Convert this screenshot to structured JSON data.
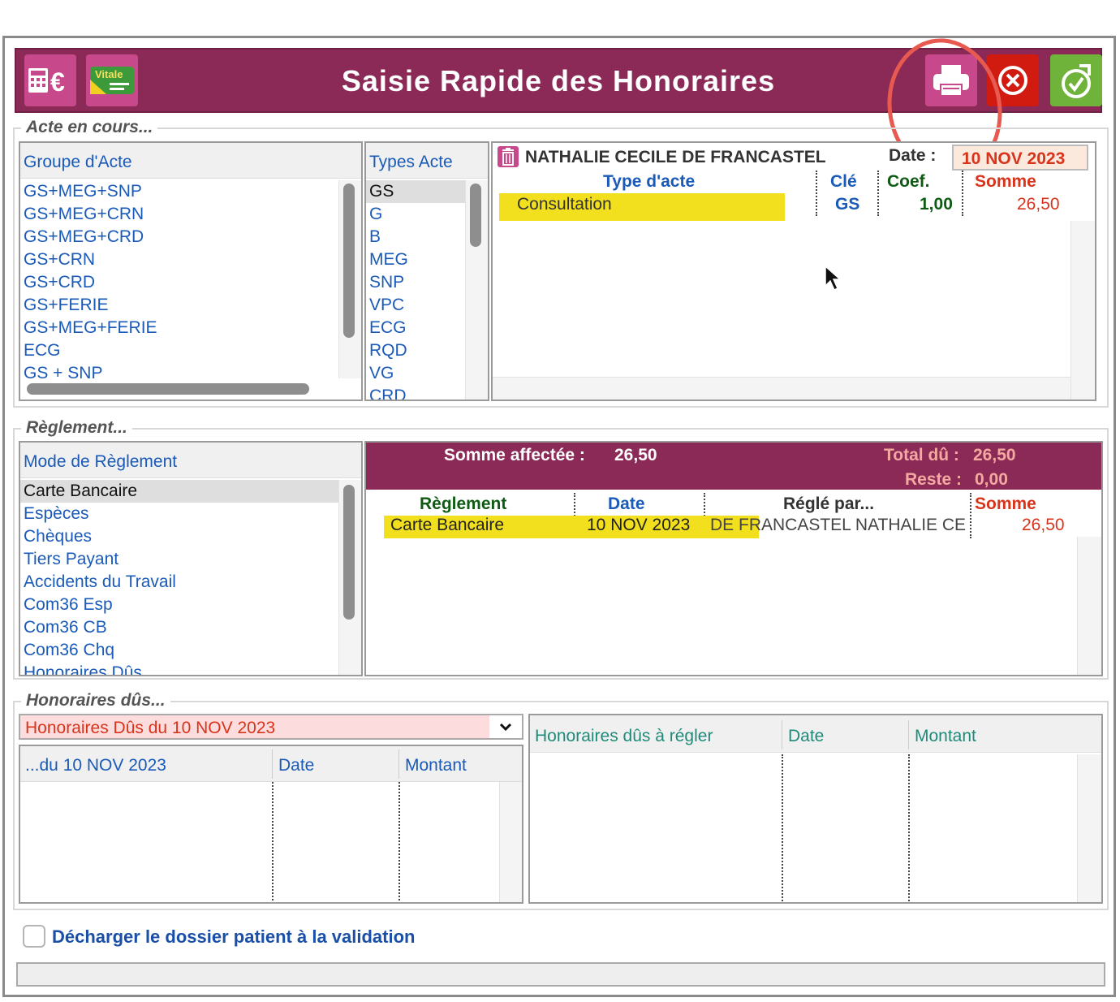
{
  "header": {
    "title": "Saisie Rapide des Honoraires",
    "calc_icon_text": "€",
    "vitale_icon_text": "Vitale"
  },
  "acte": {
    "legend": "Acte en cours...",
    "groupe_header": "Groupe d'Acte",
    "groupe_items": [
      "GS+MEG+SNP",
      "GS+MEG+CRN",
      "GS+MEG+CRD",
      "GS+CRN",
      "GS+CRD",
      "GS+FERIE",
      "GS+MEG+FERIE",
      "ECG",
      "GS + SNP"
    ],
    "types_header": "Types Acte",
    "types_items": [
      "GS",
      "G",
      "B",
      "MEG",
      "SNP",
      "VPC",
      "ECG",
      "RQD",
      "VG",
      "CRD"
    ],
    "patient_name": "NATHALIE CECILE DE FRANCASTEL",
    "date_label": "Date :",
    "date_value": "10 NOV 2023",
    "col_type": "Type d'acte",
    "col_cle": "Clé",
    "col_coef": "Coef.",
    "col_somme": "Somme",
    "row": {
      "type": "Consultation",
      "cle": "GS",
      "coef": "1,00",
      "somme": "26,50"
    }
  },
  "reglement": {
    "legend": "Règlement...",
    "mode_header": "Mode de Règlement",
    "mode_items": [
      "Carte Bancaire",
      "Espèces",
      "Chèques",
      "Tiers Payant",
      "Accidents du Travail",
      "Com36 Esp",
      "Com36 CB",
      "Com36 Chq",
      "Honoraires Dûs"
    ],
    "somme_affectee_label": "Somme affectée :",
    "somme_affectee_value": "26,50",
    "total_du_label": "Total dû :",
    "total_du_value": "26,50",
    "reste_label": "Reste :",
    "reste_value": "0,00",
    "col_reglement": "Règlement",
    "col_date": "Date",
    "col_regle_par": "Réglé par...",
    "col_somme": "Somme",
    "row": {
      "reglement": "Carte Bancaire",
      "date": "10 NOV 2023",
      "regle_par": "DE FRANCASTEL NATHALIE CE",
      "somme": "26,50"
    }
  },
  "honoraires": {
    "legend": "Honoraires dûs...",
    "dropdown_value": "Honoraires Dûs du 10 NOV 2023",
    "left_col_1": "...du 10 NOV 2023",
    "left_col_2": "Date",
    "left_col_3": "Montant",
    "right_col_1": "Honoraires dûs à régler",
    "right_col_2": "Date",
    "right_col_3": "Montant"
  },
  "footer": {
    "checkbox_label": "Décharger le dossier patient à la validation",
    "checkbox_checked": false
  },
  "colors": {
    "titlebar": "#8b2a57",
    "accent_pink": "#c8498b",
    "link_blue": "#1a5ab8",
    "header_green": "#0f5b14",
    "amount_red": "#d8341c",
    "highlight_yellow": "#f2df1e",
    "annotation_circle": "#e85a4f"
  }
}
